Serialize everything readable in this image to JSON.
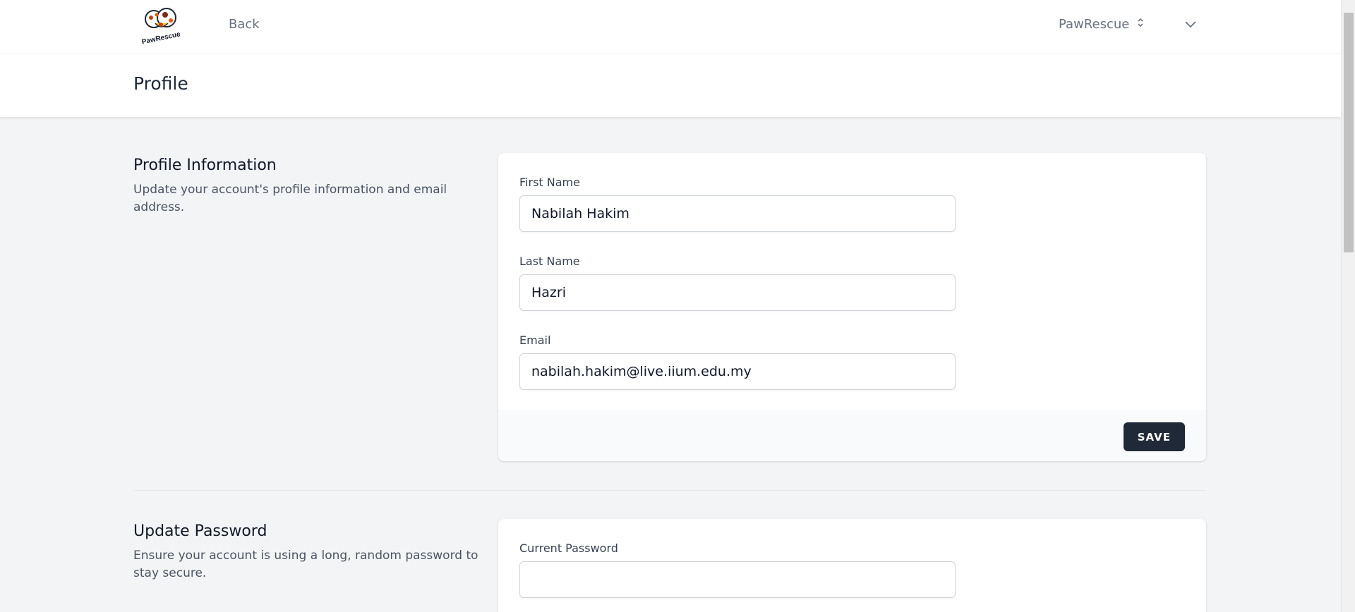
{
  "nav": {
    "logo_text": "PawRescue",
    "back_label": "Back",
    "team_name": "PawRescue"
  },
  "header": {
    "title": "Profile"
  },
  "profile_info": {
    "title": "Profile Information",
    "description": "Update your account's profile information and email address.",
    "first_name_label": "First Name",
    "first_name_value": "Nabilah Hakim",
    "last_name_label": "Last Name",
    "last_name_value": "Hazri",
    "email_label": "Email",
    "email_value": "nabilah.hakim@live.iium.edu.my",
    "save_label": "SAVE"
  },
  "update_password": {
    "title": "Update Password",
    "description": "Ensure your account is using a long, random password to stay secure.",
    "current_password_label": "Current Password",
    "current_password_value": ""
  },
  "colors": {
    "background": "#f3f4f6",
    "button": "#1f2937",
    "logo_accent": "#c2410c"
  }
}
